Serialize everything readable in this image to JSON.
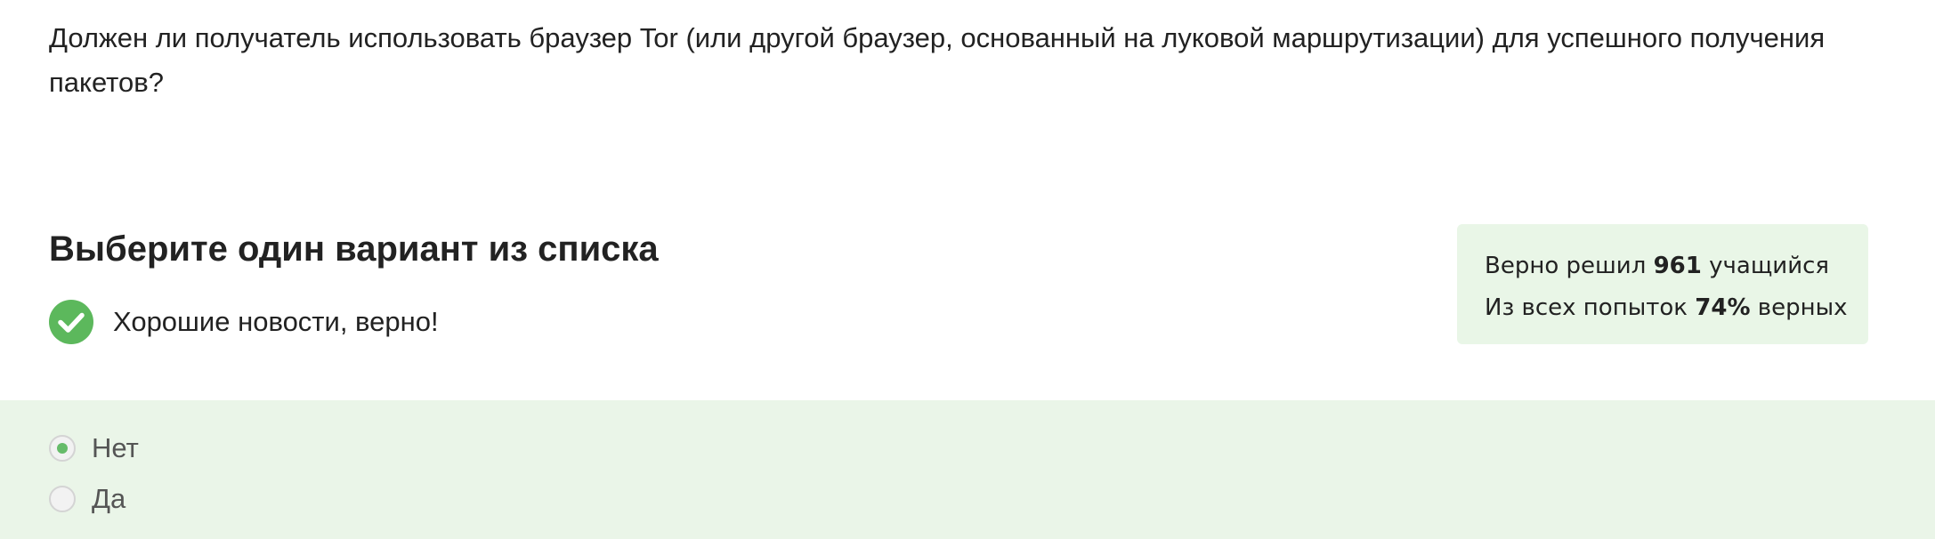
{
  "question": {
    "text": "Должен ли получатель использовать браузер Tor (или другой браузер, основанный на луковой маршрутизации) для успешного получения пакетов?"
  },
  "instruction": {
    "title": "Выберите один вариант из списка"
  },
  "feedback": {
    "icon": "check-circle-icon",
    "text": "Хорошие новости, верно!",
    "color": "#5cb85c"
  },
  "stats": {
    "solved_prefix": "Верно решил ",
    "solved_count": "961",
    "solved_suffix": " учащийся",
    "attempts_prefix": "Из всех попыток ",
    "attempts_percent": "74%",
    "attempts_suffix": " верных",
    "background": "#e9f6e7"
  },
  "options": [
    {
      "label": "Нет",
      "selected": true
    },
    {
      "label": "Да",
      "selected": false
    }
  ],
  "colors": {
    "accent_green": "#66bb6a",
    "options_background": "#eaf5e8"
  }
}
